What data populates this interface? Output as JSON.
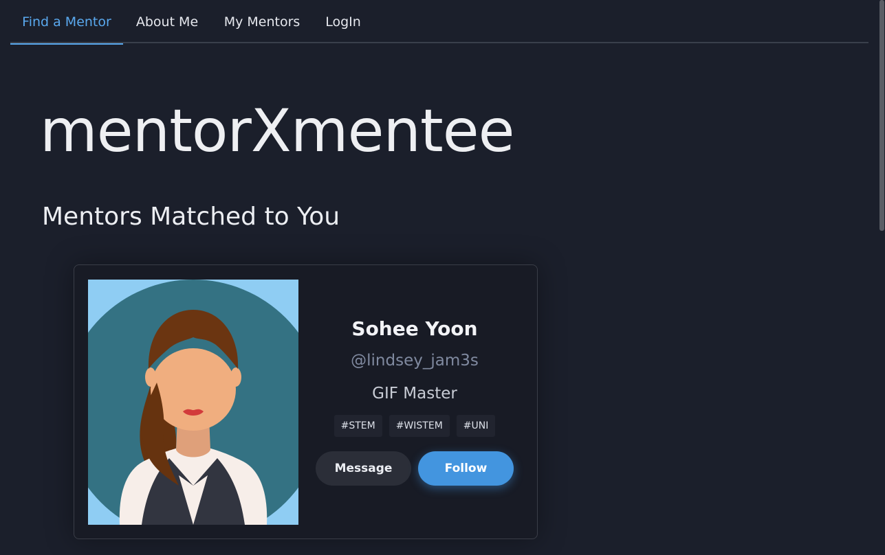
{
  "nav": {
    "tabs": [
      {
        "label": "Find a Mentor",
        "active": true
      },
      {
        "label": "About Me",
        "active": false
      },
      {
        "label": "My Mentors",
        "active": false
      },
      {
        "label": "LogIn",
        "active": false
      }
    ]
  },
  "app": {
    "title": "mentorXmentee"
  },
  "section": {
    "title": "Mentors Matched to You"
  },
  "mentor_card": {
    "name": "Sohee Yoon",
    "handle": "@lindsey_jam3s",
    "role": "GIF Master",
    "tags": [
      "#STEM",
      "#WISTEM",
      "#UNI"
    ],
    "message_label": "Message",
    "follow_label": "Follow",
    "avatar_icon": "woman-avatar-icon"
  },
  "colors": {
    "background": "#1b1f2b",
    "accent": "#5aa9ef",
    "follow_button": "#4395df",
    "avatar_background": "#8fcdf3"
  }
}
